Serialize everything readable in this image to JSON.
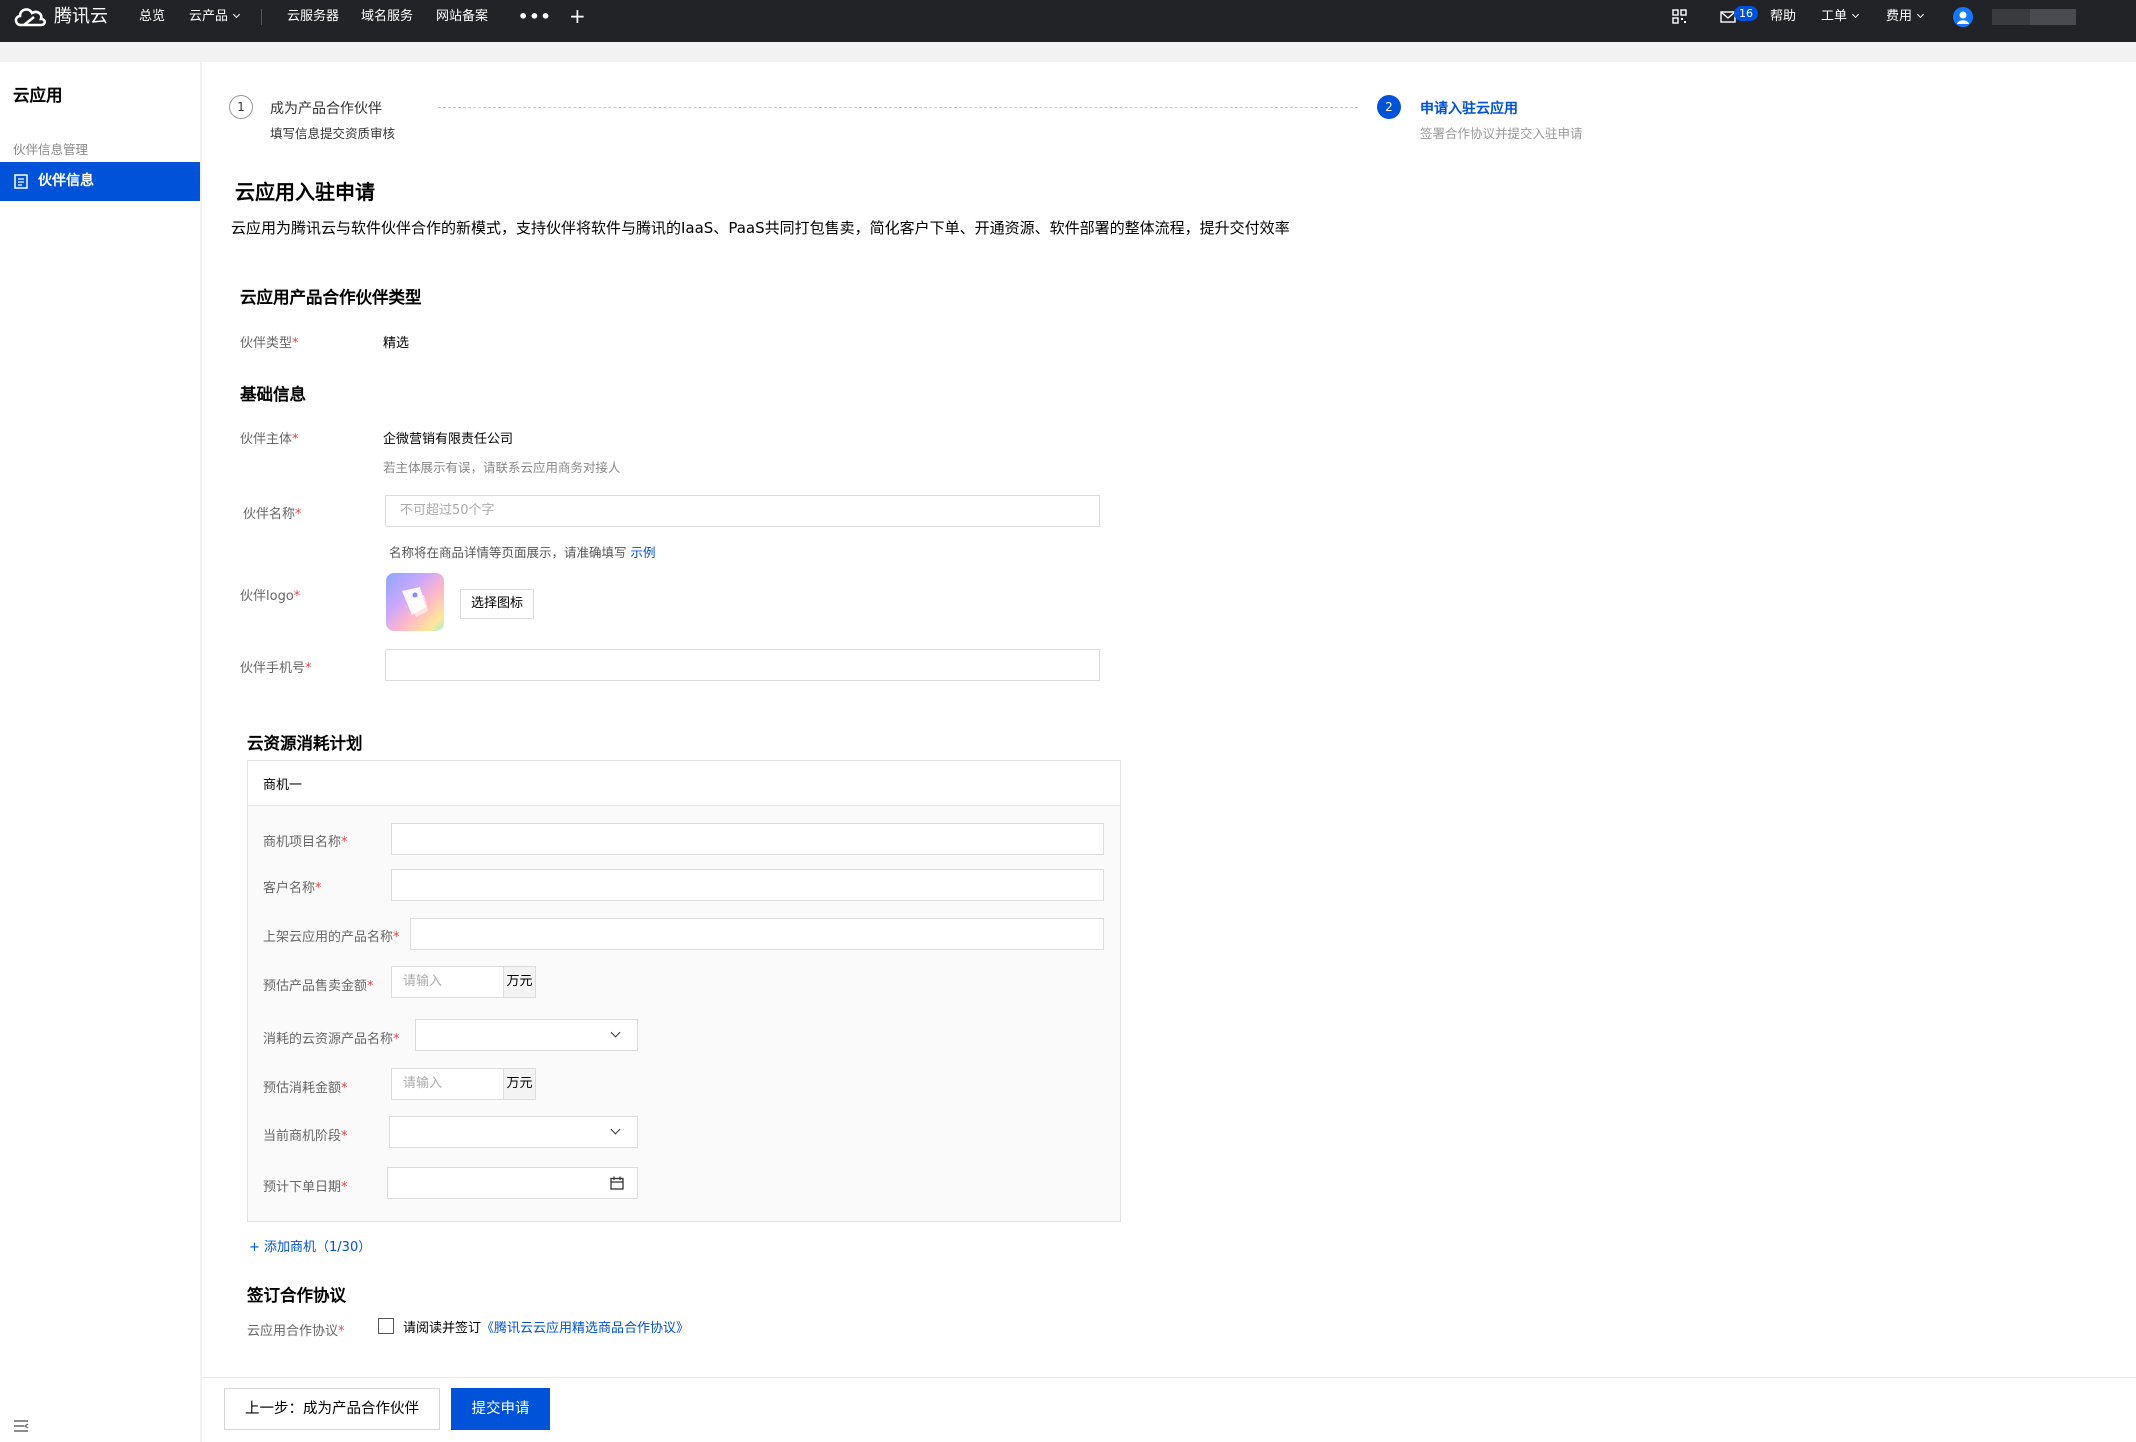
{
  "topbar": {
    "logo_text": "腾讯云",
    "nav": [
      "总览",
      "云产品",
      "云服务器",
      "域名服务",
      "网站备案"
    ],
    "msg_count": "16",
    "help": "帮助",
    "ticket": "工单",
    "billing": "费用"
  },
  "sidebar": {
    "title": "云应用",
    "group_label": "伙伴信息管理",
    "active_item": "伙伴信息"
  },
  "steps": [
    {
      "num": "1",
      "title": "成为产品合作伙伴",
      "desc": "填写信息提交资质审核"
    },
    {
      "num": "2",
      "title": "申请入驻云应用",
      "desc": "签署合作协议并提交入驻申请"
    }
  ],
  "page": {
    "title": "云应用入驻申请",
    "intro": "云应用为腾讯云与软件伙伴合作的新模式，支持伙伴将软件与腾讯的IaaS、PaaS共同打包售卖，简化客户下单、开通资源、软件部署的整体流程，提升交付效率"
  },
  "partner_type": {
    "section": "云应用产品合作伙伴类型",
    "label": "伙伴类型",
    "value": "精选"
  },
  "basic": {
    "section": "基础信息",
    "entity_label": "伙伴主体",
    "entity_value": "企微营销有限责任公司",
    "entity_hint": "若主体展示有误，请联系云应用商务对接人",
    "name_label": "伙伴名称",
    "name_placeholder": "不可超过50个字",
    "name_hint": "名称将在商品详情等页面展示，请准确填写",
    "name_hint_link": "示例",
    "logo_label": "伙伴logo",
    "logo_button": "选择图标",
    "phone_label": "伙伴手机号"
  },
  "plan": {
    "section": "云资源消耗计划",
    "card_title": "商机一",
    "project_label": "商机项目名称",
    "customer_label": "客户名称",
    "product_label": "上架云应用的产品名称",
    "sales_label": "预估产品售卖金额",
    "sales_placeholder": "请输入",
    "unit": "万元",
    "resource_label": "消耗的云资源产品名称",
    "consume_label": "预估消耗金额",
    "consume_placeholder": "请输入",
    "stage_label": "当前商机阶段",
    "date_label": "预计下单日期",
    "add_link": "+ 添加商机（1/30）"
  },
  "agreement": {
    "section": "签订合作协议",
    "label": "云应用合作协议",
    "text_prefix": "请阅读并签订",
    "link": "《腾讯云云应用精选商品合作协议》"
  },
  "footer": {
    "prev_button": "上一步：成为产品合作伙伴",
    "submit_button": "提交申请"
  }
}
